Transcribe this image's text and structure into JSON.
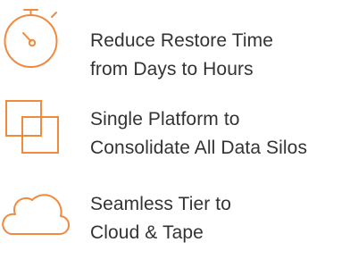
{
  "accent_color": "#f08a3e",
  "text_color": "#333333",
  "features": [
    {
      "icon": "stopwatch-icon",
      "line1": "Reduce Restore Time",
      "line2": "from Days to Hours"
    },
    {
      "icon": "overlapping-squares-icon",
      "line1": "Single Platform to",
      "line2": "Consolidate All Data Silos"
    },
    {
      "icon": "cloud-icon",
      "line1": "Seamless Tier to",
      "line2": "Cloud & Tape"
    }
  ]
}
